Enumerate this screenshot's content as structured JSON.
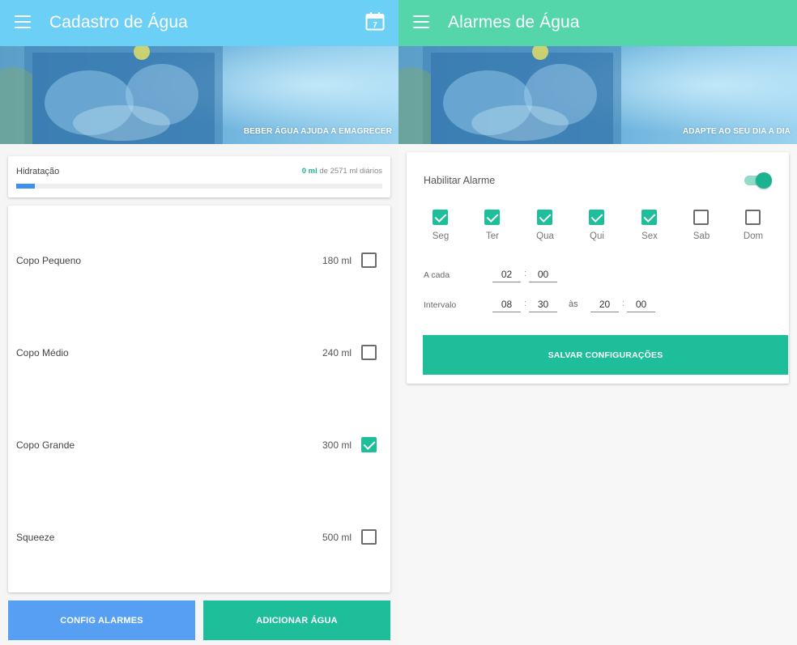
{
  "left": {
    "title": "Cadastro de Água",
    "calendar_day": "7",
    "banner_caption": "BEBER ÁGUA AJUDA A EMAGRECER",
    "appbar_color": "#6ccff6",
    "hydration": {
      "label": "Hidratação",
      "current": "0 ml",
      "rest": " de 2571 ml diários",
      "progress_fraction": 0.05
    },
    "cups": [
      {
        "name": "Copo Pequeno",
        "volume": "180 ml",
        "checked": false
      },
      {
        "name": "Copo Médio",
        "volume": "240 ml",
        "checked": false
      },
      {
        "name": "Copo Grande",
        "volume": "300 ml",
        "checked": true
      },
      {
        "name": "Squeeze",
        "volume": "500 ml",
        "checked": false
      }
    ],
    "buttons": {
      "config": "CONFIG ALARMES",
      "add": "ADICIONAR ÁGUA"
    }
  },
  "right": {
    "title": "Alarmes de Água",
    "banner_caption": "ADAPTE AO SEU DIA A DIA",
    "appbar_color": "#55d6aa",
    "alarm": {
      "enable_label": "Habilitar Alarme",
      "enabled": true,
      "days": [
        {
          "label": "Seg",
          "checked": true
        },
        {
          "label": "Ter",
          "checked": true
        },
        {
          "label": "Qua",
          "checked": true
        },
        {
          "label": "Qui",
          "checked": true
        },
        {
          "label": "Sex",
          "checked": true
        },
        {
          "label": "Sab",
          "checked": false
        },
        {
          "label": "Dom",
          "checked": false
        }
      ],
      "every_label": "A cada",
      "every_hours": "02",
      "every_minutes": "00",
      "interval_label": "Intervalo",
      "start_hours": "08",
      "start_minutes": "30",
      "until_label": "às",
      "end_hours": "20",
      "end_minutes": "00",
      "save_label": "SALVAR CONFIGURAÇÕES"
    }
  },
  "colors": {
    "accent_green": "#1ebe9b",
    "accent_blue": "#579ff3",
    "progress_blue": "#3d8ff0"
  },
  "icons": {
    "menu": "hamburger-menu-icon",
    "calendar": "calendar-icon",
    "checkbox": "checkbox-icon"
  }
}
